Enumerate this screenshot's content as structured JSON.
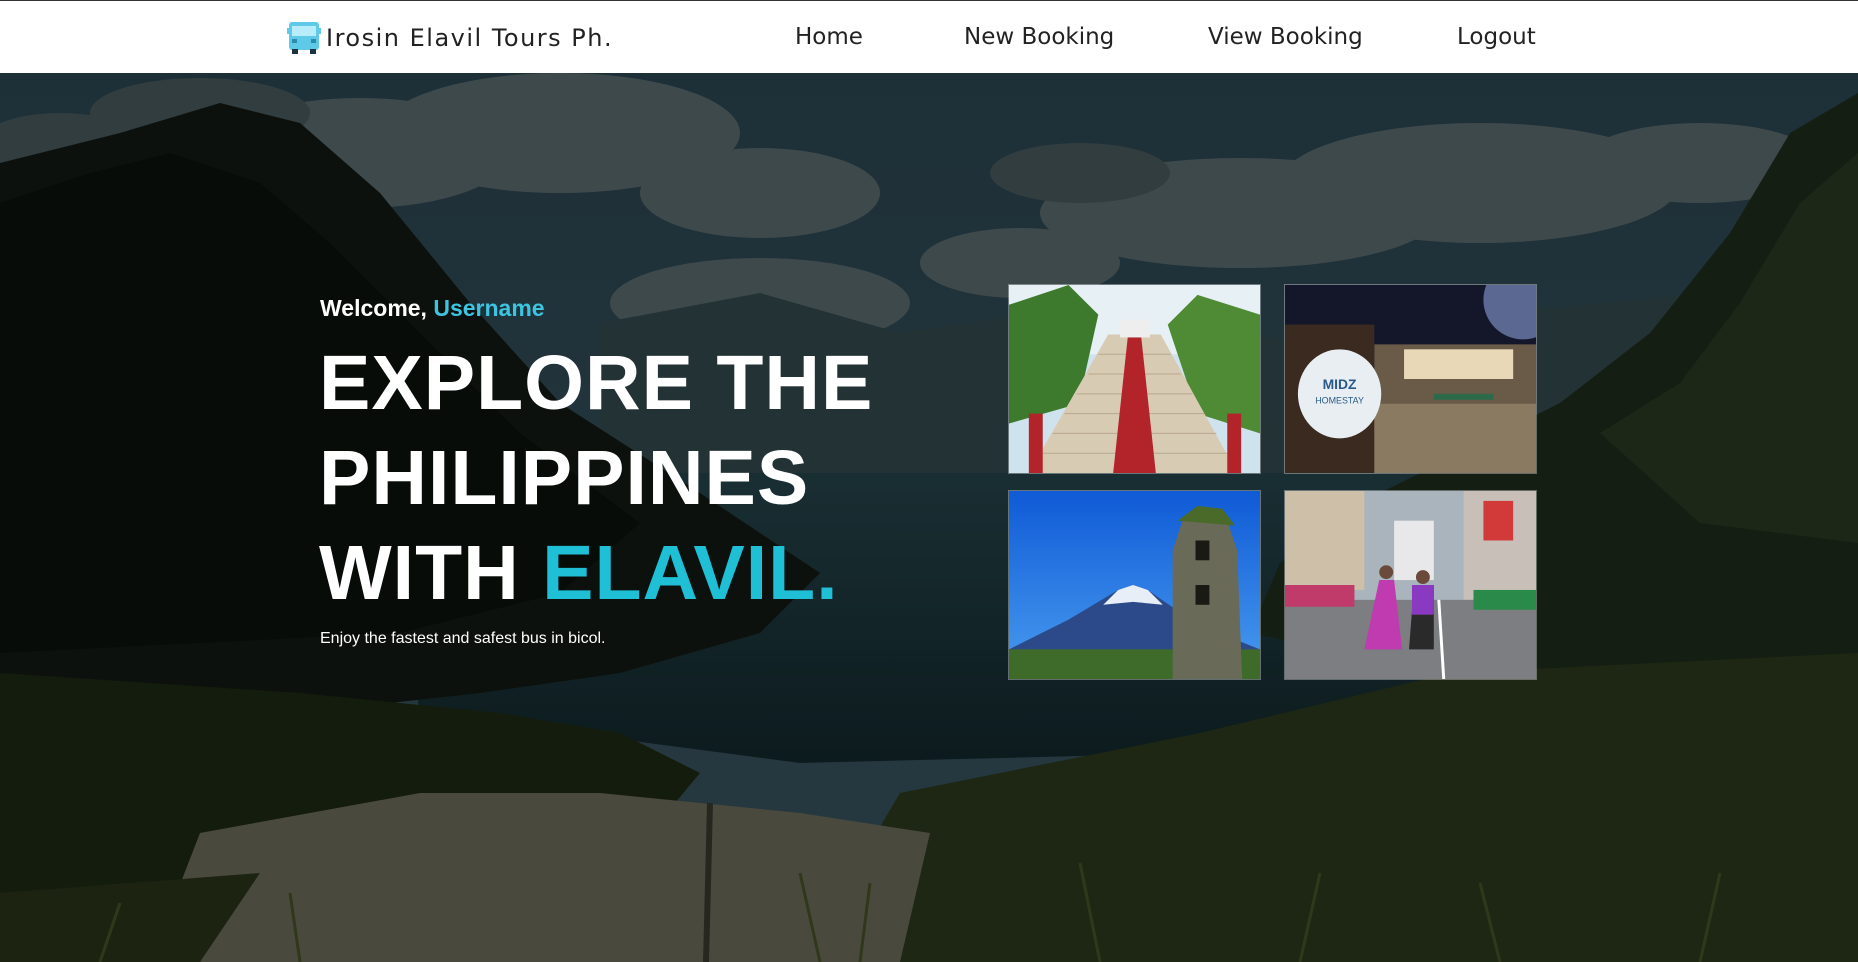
{
  "navbar": {
    "brand": "Irosin Elavil Tours Ph.",
    "brand_icon": "bus-icon",
    "links": {
      "home": "Home",
      "new_booking": "New Booking",
      "view_booking": "View Booking",
      "logout": "Logout"
    }
  },
  "hero": {
    "welcome_prefix": "Welcome,",
    "username": "Username",
    "headline_line1": "EXPLORE THE",
    "headline_line2": "PHILIPPINES",
    "headline_line3_prefix": "WITH",
    "headline_accent": "ELAVIL.",
    "tagline": "Enjoy the fastest and safest bus in bicol.",
    "background": "crater-lake-landscape"
  },
  "gallery": {
    "photos": [
      "church-stairway",
      "homestay-sign",
      "volcano-and-bell-tower",
      "street-festival-dancers"
    ]
  },
  "colors": {
    "accent": "#1fbfd6",
    "username": "#3cc4e0",
    "navbar_bg": "#ffffff",
    "nav_text": "#222222",
    "hero_text": "#ffffff"
  }
}
